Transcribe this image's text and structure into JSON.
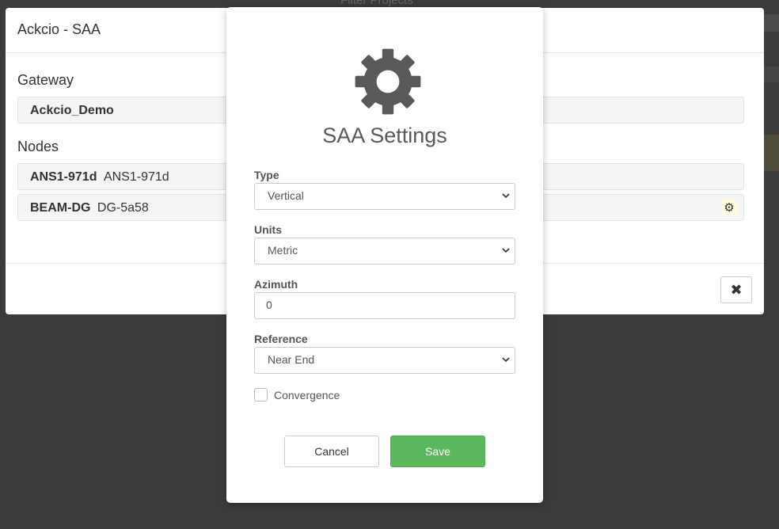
{
  "background": {
    "filter_text": "Filter Projects"
  },
  "outer_modal": {
    "title": "Ackcio - SAA",
    "gateway_label": "Gateway",
    "gateway_value": "Ackcio_Demo",
    "nodes_label": "Nodes",
    "nodes": [
      {
        "name": "ANS1-971d",
        "id": "ANS1-971d"
      },
      {
        "name": "BEAM-DG",
        "id": "DG-5a58"
      }
    ],
    "close_icon": "times-icon"
  },
  "settings_dialog": {
    "icon": "gear-icon",
    "title": "SAA Settings",
    "type": {
      "label": "Type",
      "value": "Vertical"
    },
    "units": {
      "label": "Units",
      "value": "Metric"
    },
    "azimuth": {
      "label": "Azimuth",
      "value": "0"
    },
    "reference": {
      "label": "Reference",
      "value": "Near End"
    },
    "convergence": {
      "label": "Convergence",
      "checked": false
    },
    "cancel_label": "Cancel",
    "save_label": "Save"
  },
  "colors": {
    "backdrop": "#3b3b3b",
    "save_button": "#5cb85c",
    "gear": "#595959"
  }
}
